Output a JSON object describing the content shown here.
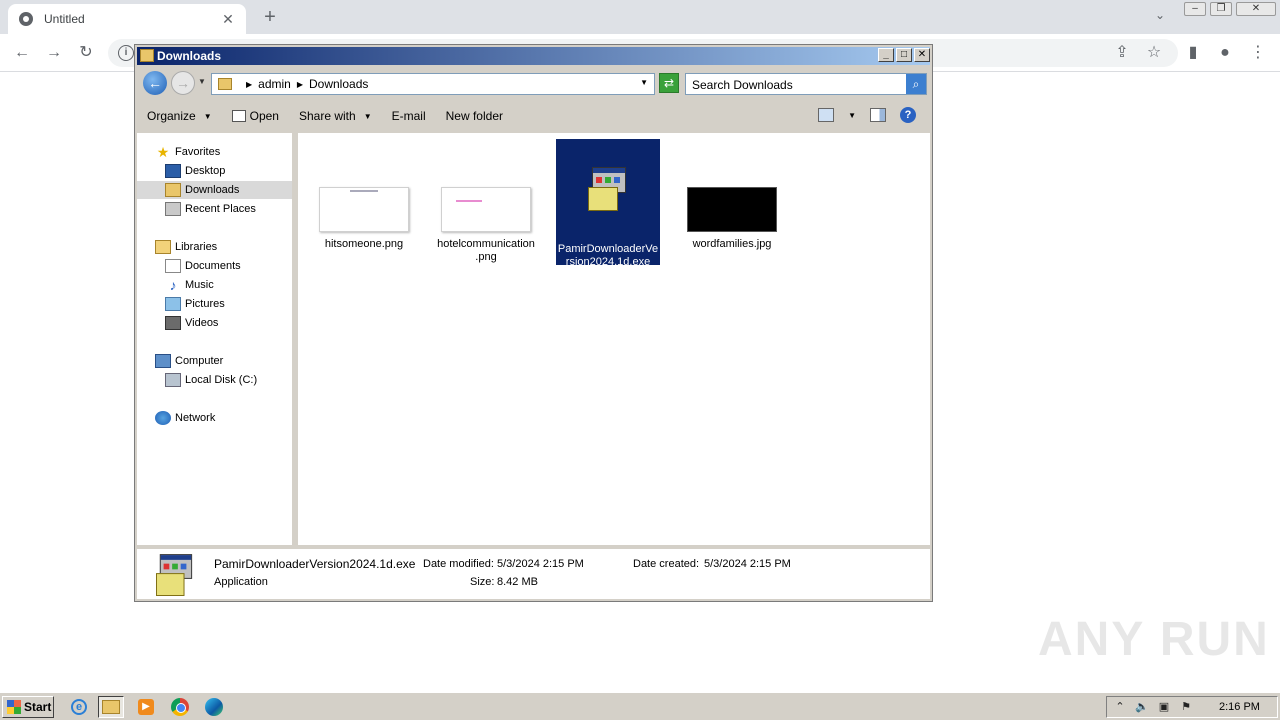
{
  "browser": {
    "tab_title": "Untitled",
    "tab_close": "✕",
    "new_tab": "+"
  },
  "window": {
    "title": "Downloads",
    "minimize": "_",
    "maximize": "□",
    "close": "✕"
  },
  "address": {
    "segments": [
      "admin",
      "Downloads"
    ],
    "search_placeholder": "Search Downloads"
  },
  "commands": {
    "organize": "Organize",
    "open": "Open",
    "share_with": "Share with",
    "email": "E-mail",
    "new_folder": "New folder"
  },
  "nav": {
    "favorites": "Favorites",
    "desktop": "Desktop",
    "downloads": "Downloads",
    "recent_places": "Recent Places",
    "libraries": "Libraries",
    "documents": "Documents",
    "music": "Music",
    "pictures": "Pictures",
    "videos": "Videos",
    "computer": "Computer",
    "local_disk": "Local Disk (C:)",
    "network": "Network"
  },
  "files": [
    {
      "name": "hitsomeone.png",
      "type": "image-white"
    },
    {
      "name": "hotelcommunication.png",
      "type": "image-white-pink"
    },
    {
      "name": "PamirDownloaderVersion2024.1d.exe",
      "type": "exe",
      "selected": true
    },
    {
      "name": "wordfamilies.jpg",
      "type": "image-black"
    }
  ],
  "file_labels": {
    "f0": "hitsomeone.png",
    "f1_line1": "hotelcommunication",
    "f1_line2": ".png",
    "f2_line1": "PamirDownloaderVe",
    "f2_line2": "rsion2024.1d.exe",
    "f3": "wordfamilies.jpg"
  },
  "details": {
    "name": "PamirDownloaderVersion2024.1d.exe",
    "type": "Application",
    "date_modified_label": "Date modified:",
    "date_modified": "5/3/2024 2:15 PM",
    "size_label": "Size:",
    "size": "8.42 MB",
    "date_created_label": "Date created:",
    "date_created": "5/3/2024 2:15 PM"
  },
  "taskbar": {
    "start": "Start",
    "clock": "2:16 PM"
  },
  "watermark": "ANY RUN"
}
